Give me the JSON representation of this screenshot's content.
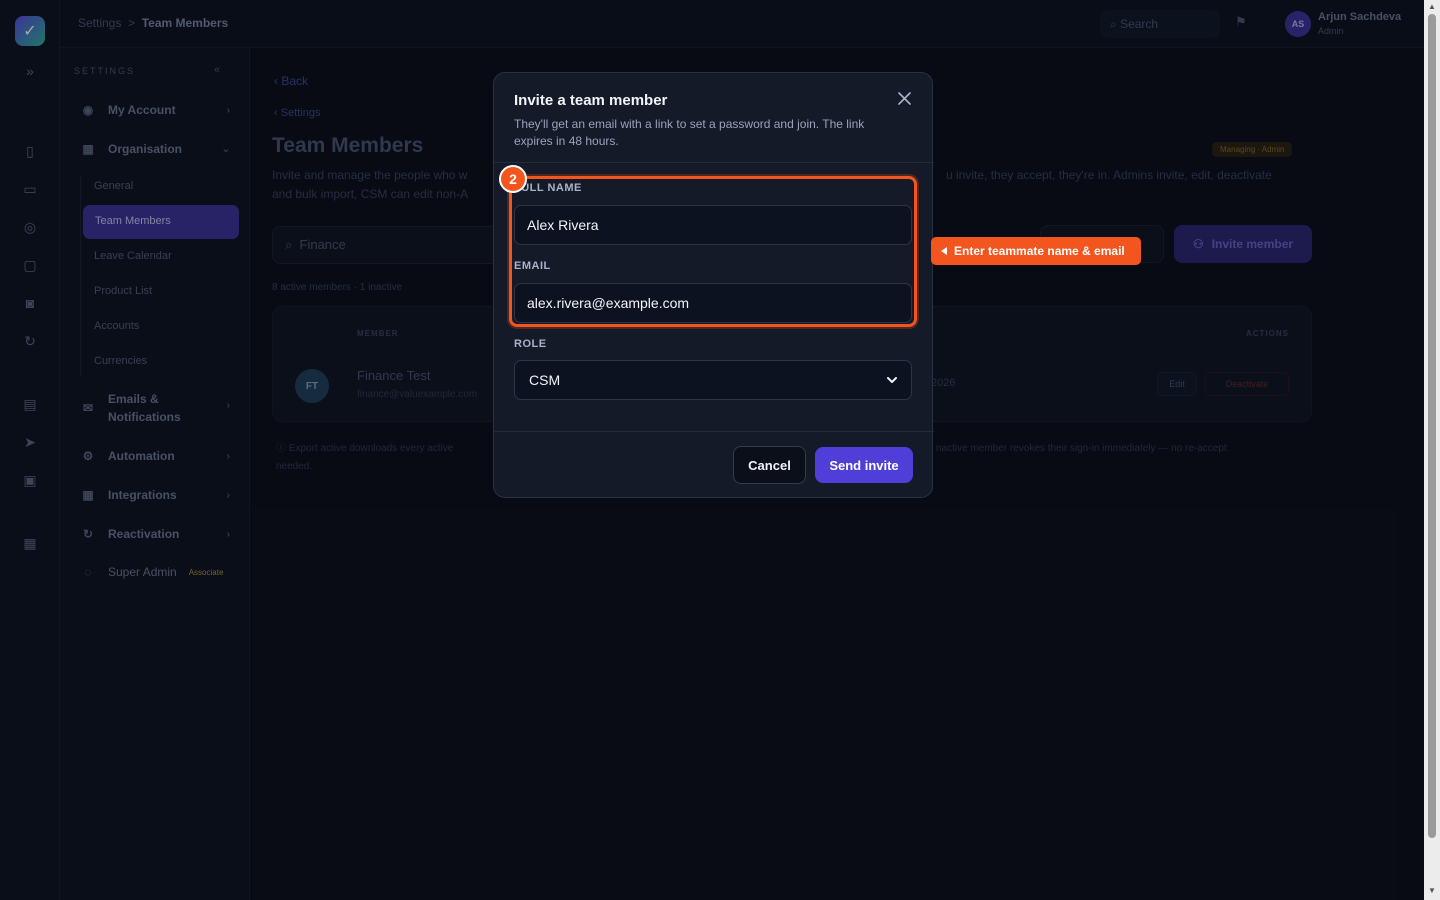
{
  "topbar": {
    "breadcrumb_root": "Settings",
    "breadcrumb_sep": ">",
    "breadcrumb_current": "Team Members",
    "search_placeholder": "Search",
    "user_initials": "AS",
    "user_name": "Arjun Sachdeva",
    "user_role": "Admin"
  },
  "sidebar": {
    "heading": "SETTINGS",
    "items": [
      {
        "label": "My Account"
      },
      {
        "label": "Organisation"
      },
      {
        "label": "Emails &"
      },
      {
        "label": "Notifications"
      },
      {
        "label": "Automation"
      },
      {
        "label": "Integrations"
      },
      {
        "label": "Reactivation"
      },
      {
        "label": "Super Admin"
      }
    ],
    "super_admin_badge": "Associate",
    "sub_items": [
      "General",
      "Team Members",
      "Leave Calendar",
      "Product List",
      "Accounts",
      "Currencies"
    ]
  },
  "page": {
    "back": "Back",
    "breadcrumb": "Settings",
    "title": "Team Members",
    "description_left": "Invite and manage the people who w",
    "description_left_2": "and bulk import, CSM can edit non-A",
    "description_right": "u invite, they accept, they're in. Admins invite, edit, deactivate",
    "managing_pill": "Managing · Admin",
    "search_value": "Finance",
    "invite_button": "Invite member",
    "count": "8 active members · 1 inactive",
    "col_member": "MEMBER",
    "col_actions": "ACTIONS",
    "row_initials": "FT",
    "row_name": "Finance Test",
    "row_email": "finance@valuexample.com",
    "row_date": "2026",
    "row_edit": "Edit",
    "row_deactivate": "Deactivate",
    "footer_left": "Export active downloads every active",
    "footer_left_2": "needed.",
    "footer_right": "nactive member revokes their sign-in immediately — no re-accept"
  },
  "modal": {
    "title": "Invite a team member",
    "subtitle": "They'll get an email with a link to set a password and join. The link expires in 48 hours.",
    "full_name_label": "FULL NAME",
    "full_name_value": "Alex Rivera",
    "email_label": "EMAIL",
    "email_value": "alex.rivera@example.com",
    "role_label": "ROLE",
    "role_value": "CSM",
    "cancel": "Cancel",
    "send": "Send invite"
  },
  "tutorial": {
    "step_number": "2",
    "callout": "Enter teammate name & email",
    "accent": "#f2551d"
  },
  "colors": {
    "brand": "#4f3fd8",
    "background": "#0b0f1a",
    "modal": "#141a28"
  }
}
